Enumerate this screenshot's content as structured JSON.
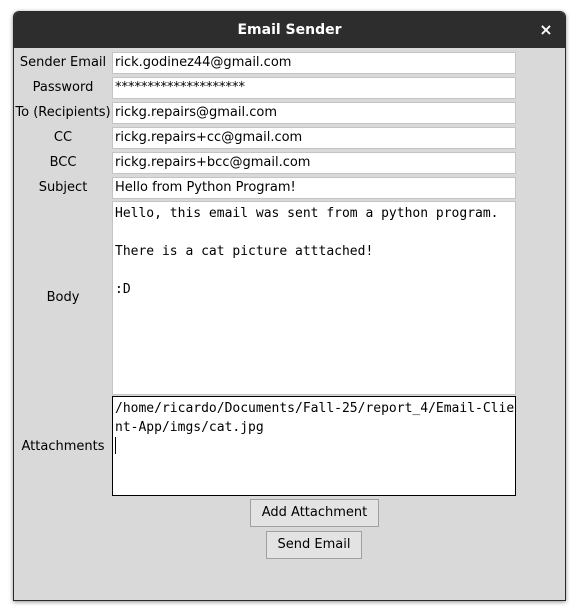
{
  "window": {
    "title": "Email Sender",
    "close_glyph": "×"
  },
  "form": {
    "sender_email": {
      "label": "Sender Email",
      "value": "rick.godinez44@gmail.com"
    },
    "password": {
      "label": "Password",
      "value": "********************"
    },
    "to": {
      "label": "To (Recipients)",
      "value": "rickg.repairs@gmail.com"
    },
    "cc": {
      "label": "CC",
      "value": "rickg.repairs+cc@gmail.com"
    },
    "bcc": {
      "label": "BCC",
      "value": "rickg.repairs+bcc@gmail.com"
    },
    "subject": {
      "label": "Subject",
      "value": "Hello from Python Program!"
    },
    "body": {
      "label": "Body",
      "value": "Hello, this email was sent from a python program.\n\nThere is a cat picture atttached!\n\n:D"
    },
    "attachments": {
      "label": "Attachments",
      "value": "/home/ricardo/Documents/Fall-25/report_4/Email-Client-App/imgs/cat.jpg"
    }
  },
  "buttons": {
    "add_attachment": "Add Attachment",
    "send_email": "Send Email"
  }
}
